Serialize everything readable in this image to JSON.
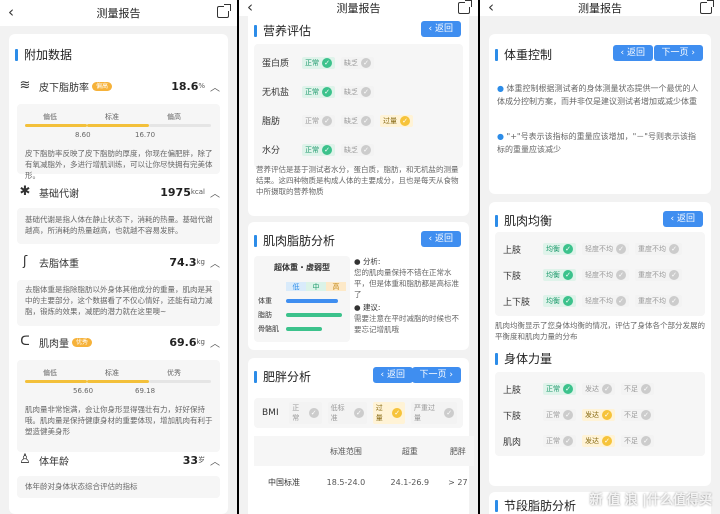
{
  "panel1": {
    "title": "测量报告",
    "section": "附加数据",
    "fat": {
      "label": "皮下脂肪率",
      "badge": "偏高",
      "value": "18.6",
      "unit": "%",
      "bands": [
        "偏低",
        "标准",
        "偏高"
      ],
      "ticks": [
        "8.60",
        "16.70"
      ],
      "level_pct": 79,
      "desc": "皮下脂肪率反映了皮下脂肪的厚度，你现在偏肥胖，除了有氧减脂外，多进行增肌训练，可以让你尽快拥有完美体形。"
    },
    "bmr": {
      "label": "基础代谢",
      "value": "1975",
      "unit": "kcal",
      "desc": "基础代谢是指人体在静止状态下，消耗的热量。基础代谢越高，所消耗的热量越高，也就越不容易发胖。"
    },
    "lean": {
      "label": "去脂体重",
      "value": "74.3",
      "unit": "kg",
      "desc": "去脂体重是指除脂肪以外身体其他成分的重量，肌肉是其中的主要部分，这个数据看了不仅心情好，还能有动力减脂，锻炼的效果，减肥的潜力就在这里噢~"
    },
    "muscle": {
      "label": "肌肉量",
      "badge": "优秀",
      "value": "69.6",
      "unit": "kg",
      "bands": [
        "偏低",
        "标准",
        "优秀"
      ],
      "ticks": [
        "56.60",
        "69.18"
      ],
      "level_pct": 69,
      "desc": "肌肉量非常饱满，会让你身形显得强壮有力，好好保持哦。肌肉量是保持健康身材的重要体现，增加肌肉有利于塑造健美身形"
    },
    "age": {
      "label": "体年龄",
      "value": "33",
      "unit": "岁",
      "desc": "体年龄对身体状态综合评估的指标"
    }
  },
  "panel2": {
    "title": "测量报告",
    "nutrition": {
      "title": "营养评估",
      "back": "返回",
      "rows": [
        {
          "name": "蛋白质",
          "chips": [
            {
              "t": "正常",
              "s": "g"
            },
            {
              "t": "缺乏",
              "s": "n"
            }
          ]
        },
        {
          "name": "无机盐",
          "chips": [
            {
              "t": "正常",
              "s": "g"
            },
            {
              "t": "缺乏",
              "s": "n"
            }
          ]
        },
        {
          "name": "脂肪",
          "chips": [
            {
              "t": "正常",
              "s": "n"
            },
            {
              "t": "缺乏",
              "s": "n"
            },
            {
              "t": "过量",
              "s": "y"
            }
          ]
        },
        {
          "name": "水分",
          "chips": [
            {
              "t": "正常",
              "s": "g"
            },
            {
              "t": "缺乏",
              "s": "n"
            }
          ]
        }
      ],
      "desc": "营养评估是基于测试者水分，蛋白质，脂肪，和无机盐的测量结果。这四种物质是构成人体的主要成分，且也是每天从食物中所摄取的营养物质"
    },
    "muscle_fat": {
      "title": "肌肉脂肪分析",
      "back": "返回",
      "chart_title": "超体重・虚弱型",
      "cols": [
        "低",
        "中",
        "高"
      ],
      "rows": [
        "体重",
        "脂肪",
        "骨骼肌"
      ],
      "analysis_label": "分析:",
      "analysis": "您的肌肉量保持不错在正常水平，但是体重和脂肪都是高标准了",
      "advice_label": "建议:",
      "advice": "需要注意在平时减脂的时候也不要忘记增肌哦"
    },
    "obesity": {
      "title": "肥胖分析",
      "back": "返回",
      "next": "下一页",
      "bmi_label": "BMI",
      "bmi_chips": [
        {
          "t": "正常",
          "s": "n"
        },
        {
          "t": "低标准",
          "s": "n"
        },
        {
          "t": "过量",
          "s": "y"
        },
        {
          "t": "严重过量",
          "s": "n"
        }
      ],
      "headers": [
        "",
        "标准范围",
        "超重",
        "肥胖"
      ],
      "row": [
        "中国标准",
        "18.5-24.0",
        "24.1-26.9",
        "> 27"
      ]
    }
  },
  "panel3": {
    "title": "测量报告",
    "weight": {
      "title": "体重控制",
      "back": "返回",
      "next": "下一页",
      "b1": "体重控制根据测试者的身体测量状态提供一个最优的人体成分控制方案，而并非仅是建议测试者增加或减少体重",
      "b2": "\"+\"号表示该指标的重量应该增加，\"－\"号则表示该指标的重量应该减少"
    },
    "balance": {
      "title": "肌肉均衡",
      "back": "返回",
      "rows": [
        {
          "name": "上肢",
          "chips": [
            {
              "t": "均衡",
              "s": "g"
            },
            {
              "t": "轻度不均",
              "s": "n"
            },
            {
              "t": "重度不均",
              "s": "n"
            }
          ]
        },
        {
          "name": "下肢",
          "chips": [
            {
              "t": "均衡",
              "s": "g"
            },
            {
              "t": "轻度不均",
              "s": "n"
            },
            {
              "t": "重度不均",
              "s": "n"
            }
          ]
        },
        {
          "name": "上下肢",
          "chips": [
            {
              "t": "均衡",
              "s": "g"
            },
            {
              "t": "轻度不均",
              "s": "n"
            },
            {
              "t": "重度不均",
              "s": "n"
            }
          ]
        }
      ],
      "desc": "肌肉均衡显示了您身体均衡的情况，评估了身体各个部分发展的平衡度和肌肉力量的分布"
    },
    "strength": {
      "title": "身体力量",
      "rows": [
        {
          "name": "上肢",
          "chips": [
            {
              "t": "正常",
              "s": "g"
            },
            {
              "t": "发达",
              "s": "n"
            },
            {
              "t": "不足",
              "s": "n"
            }
          ]
        },
        {
          "name": "下肢",
          "chips": [
            {
              "t": "正常",
              "s": "n"
            },
            {
              "t": "发达",
              "s": "y"
            },
            {
              "t": "不足",
              "s": "n"
            }
          ]
        },
        {
          "name": "肌肉",
          "chips": [
            {
              "t": "正常",
              "s": "n"
            },
            {
              "t": "发达",
              "s": "y"
            },
            {
              "t": "不足",
              "s": "n"
            }
          ]
        }
      ]
    },
    "segment": {
      "title": "节段脂肪分析"
    },
    "watermark": "新 值 浪 |什么值得买"
  },
  "colors": {
    "accent": "#3f8ef0",
    "green": "#3cc28c",
    "yellow": "#f6c33a",
    "orange": "#f6b23a"
  }
}
